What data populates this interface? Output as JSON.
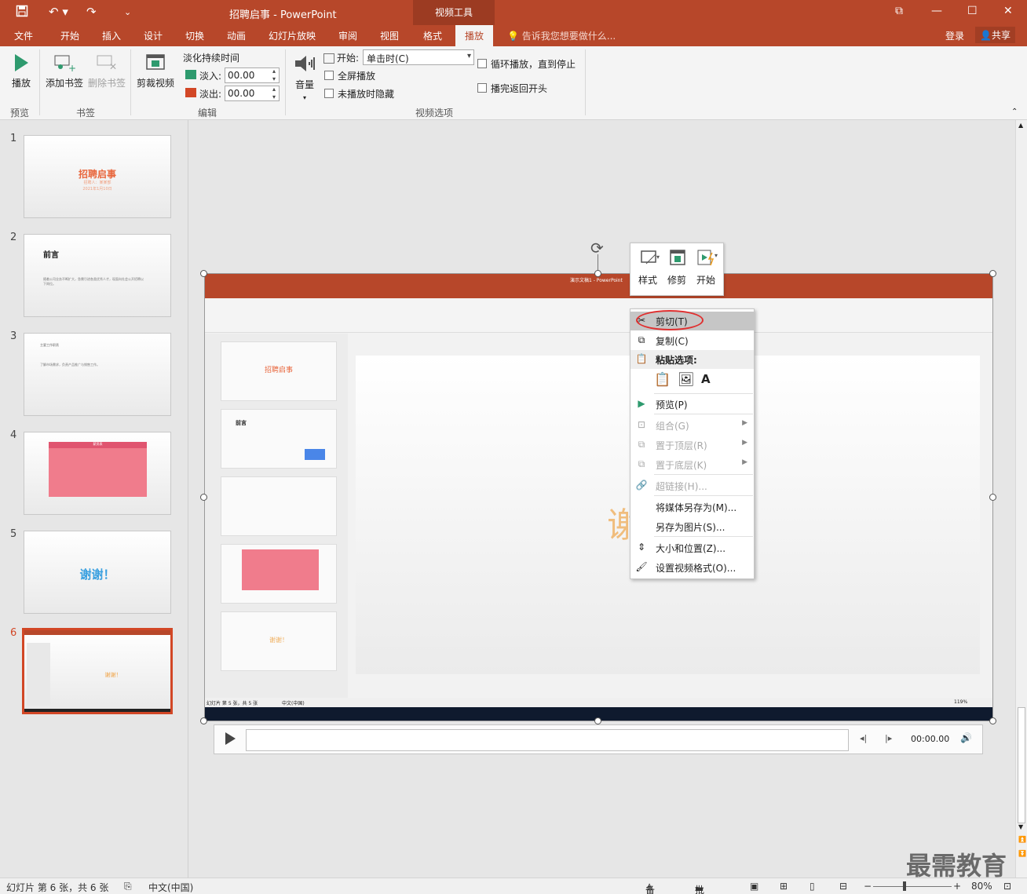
{
  "app": {
    "title": "招聘启事 - PowerPoint",
    "tools_tab": "视频工具",
    "tell_me": "告诉我您想要做什么...",
    "login": "登录",
    "share": "共享"
  },
  "tabs": [
    "文件",
    "开始",
    "插入",
    "设计",
    "切换",
    "动画",
    "幻灯片放映",
    "审阅",
    "视图",
    "格式",
    "播放"
  ],
  "active_tab": "播放",
  "ribbon": {
    "play": "播放",
    "add_bookmark": "添加书签",
    "remove_bookmark": "删除书签",
    "trim_video": "剪裁视频",
    "fade_duration": "淡化持续时间",
    "fade_in_label": "淡入:",
    "fade_in_value": "00.00",
    "fade_out_label": "淡出:",
    "fade_out_value": "00.00",
    "volume": "音量",
    "start_label": "开始:",
    "start_value": "单击时(C)",
    "fullscreen": "全屏播放",
    "hide_not_playing": "未播放时隐藏",
    "loop": "循环播放，直到停止",
    "rewind": "播完返回开头",
    "groups": {
      "preview": "预览",
      "bookmarks": "书签",
      "editing": "编辑",
      "video_options": "视频选项"
    }
  },
  "slides": [
    {
      "num": "1",
      "title": "招聘启事",
      "sub1": "招聘人：某某部",
      "sub2": "2021年1月10日"
    },
    {
      "num": "2",
      "title": "前言",
      "body": "随着公司业务不断扩大，急需引进各类优秀人才，现面向社会公开招聘以下岗位。"
    },
    {
      "num": "3",
      "title": "主要工作职责",
      "body": "了解市场需求，负责产品推广与销售工作。"
    },
    {
      "num": "4",
      "title": "薪资表"
    },
    {
      "num": "5",
      "title": "谢谢！"
    },
    {
      "num": "6",
      "title": "谢谢！"
    }
  ],
  "mini_toolbar": {
    "style": "样式",
    "trim": "修剪",
    "start": "开始"
  },
  "context_menu": {
    "cut": "剪切(T)",
    "copy": "复制(C)",
    "paste_options": "粘贴选项:",
    "preview": "预览(P)",
    "group": "组合(G)",
    "bring_front": "置于顶层(R)",
    "send_back": "置于底层(K)",
    "hyperlink": "超链接(H)...",
    "save_media": "将媒体另存为(M)...",
    "save_picture": "另存为图片(S)...",
    "size_position": "大小和位置(Z)...",
    "format_video": "设置视频格式(O)..."
  },
  "media": {
    "time": "00:00.00"
  },
  "video_frame": {
    "inner_title": "演示文稿1 - PowerPoint",
    "inner_status": "幻灯片 第 5 张，共 5 张",
    "inner_lang": "中文(中国)",
    "inner_zoom": "119%",
    "big_char": "谢",
    "inner_slide_title": "招聘启事",
    "inner_slide_title2": "前言",
    "inner_thanks": "谢谢！"
  },
  "status": {
    "slide_info": "幻灯片 第 6 张，共 6 张",
    "language": "中文(中国)",
    "notes": "备注",
    "comments": "批注",
    "zoom": "80%"
  },
  "watermark": "最需教育",
  "colors": {
    "accent": "#b7472a",
    "selection": "#d24726",
    "table_pink": "#f07c8c",
    "thanks_blue": "#3aa0e0",
    "title_orange": "#e8663c"
  }
}
